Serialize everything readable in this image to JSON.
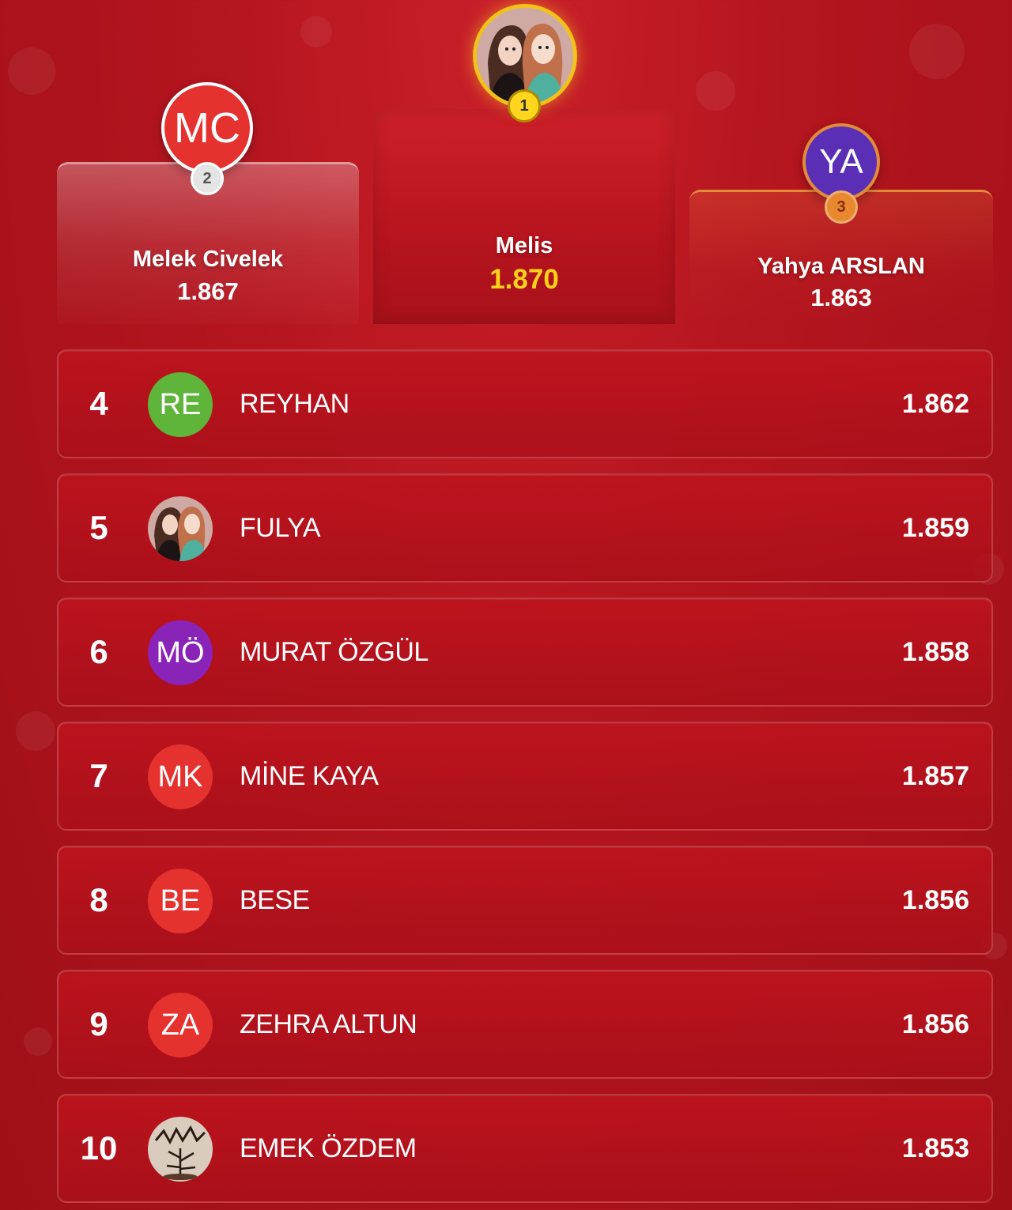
{
  "podium": {
    "first": {
      "rank": "1",
      "name": "Melis",
      "score": "1.870",
      "avatar_type": "photo-two-girls"
    },
    "second": {
      "rank": "2",
      "name": "Melek Civelek",
      "score": "1.867",
      "initials": "MC",
      "avatar_color": "#e5322f"
    },
    "third": {
      "rank": "3",
      "name": "Yahya ARSLAN",
      "score": "1.863",
      "initials": "YA",
      "avatar_color": "#5a2fb6"
    }
  },
  "leaderboard": [
    {
      "rank": "4",
      "initials": "RE",
      "name": "REYHAN",
      "score": "1.862",
      "avatar_color": "#5fb53a"
    },
    {
      "rank": "5",
      "initials": "",
      "name": "FULYA",
      "score": "1.859",
      "avatar_type": "photo-two-girls"
    },
    {
      "rank": "6",
      "initials": "MÖ",
      "name": "MURAT ÖZGÜL",
      "score": "1.858",
      "avatar_color": "#8a23b8"
    },
    {
      "rank": "7",
      "initials": "MK",
      "name": "MİNE KAYA",
      "score": "1.857",
      "avatar_color": "#e5322f"
    },
    {
      "rank": "8",
      "initials": "BE",
      "name": "BESE",
      "score": "1.856",
      "avatar_color": "#e5322f"
    },
    {
      "rank": "9",
      "initials": "ZA",
      "name": "ZEHRA ALTUN",
      "score": "1.856",
      "avatar_color": "#e5322f"
    },
    {
      "rank": "10",
      "initials": "",
      "name": "EMEK ÖZDEM",
      "score": "1.853",
      "avatar_type": "photo-emek-drawing"
    }
  ],
  "colors": {
    "background": "#b5151f",
    "gold": "#ffd21a",
    "silver": "#e4e4e4",
    "bronze": "#e8882f"
  }
}
